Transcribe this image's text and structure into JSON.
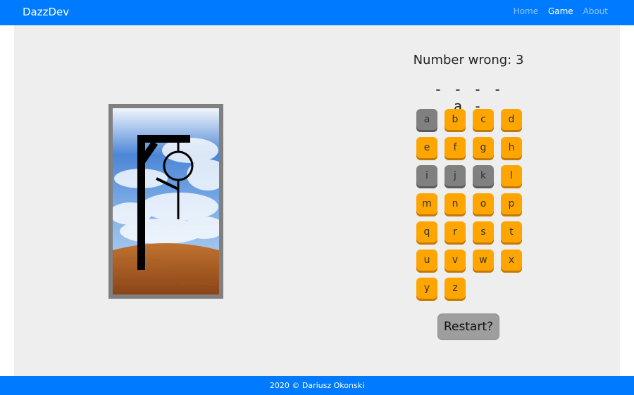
{
  "navbar": {
    "brand": "DazzDev",
    "links": [
      {
        "label": "Home",
        "active": false
      },
      {
        "label": "Game",
        "active": true
      },
      {
        "label": "About",
        "active": false
      }
    ]
  },
  "game": {
    "wrong_label": "Number wrong: 3",
    "word_display": "- - - - a -",
    "letters": [
      {
        "char": "a",
        "used": true
      },
      {
        "char": "b",
        "used": false
      },
      {
        "char": "c",
        "used": false
      },
      {
        "char": "d",
        "used": false
      },
      {
        "char": "e",
        "used": false
      },
      {
        "char": "f",
        "used": false
      },
      {
        "char": "g",
        "used": false
      },
      {
        "char": "h",
        "used": false
      },
      {
        "char": "i",
        "used": true
      },
      {
        "char": "j",
        "used": true
      },
      {
        "char": "k",
        "used": true
      },
      {
        "char": "l",
        "used": false
      },
      {
        "char": "m",
        "used": false
      },
      {
        "char": "n",
        "used": false
      },
      {
        "char": "o",
        "used": false
      },
      {
        "char": "p",
        "used": false
      },
      {
        "char": "q",
        "used": false
      },
      {
        "char": "r",
        "used": false
      },
      {
        "char": "s",
        "used": false
      },
      {
        "char": "t",
        "used": false
      },
      {
        "char": "u",
        "used": false
      },
      {
        "char": "v",
        "used": false
      },
      {
        "char": "w",
        "used": false
      },
      {
        "char": "x",
        "used": false
      },
      {
        "char": "y",
        "used": false
      },
      {
        "char": "z",
        "used": false
      }
    ],
    "restart_label": "Restart?"
  },
  "footer": {
    "text": "2020 © Dariusz Okonski"
  },
  "colors": {
    "navbar": "#007bff",
    "letter_available": "#ffa500",
    "letter_used": "#808080",
    "restart": "#9e9e9e",
    "panel_bg": "#eeeeee"
  }
}
